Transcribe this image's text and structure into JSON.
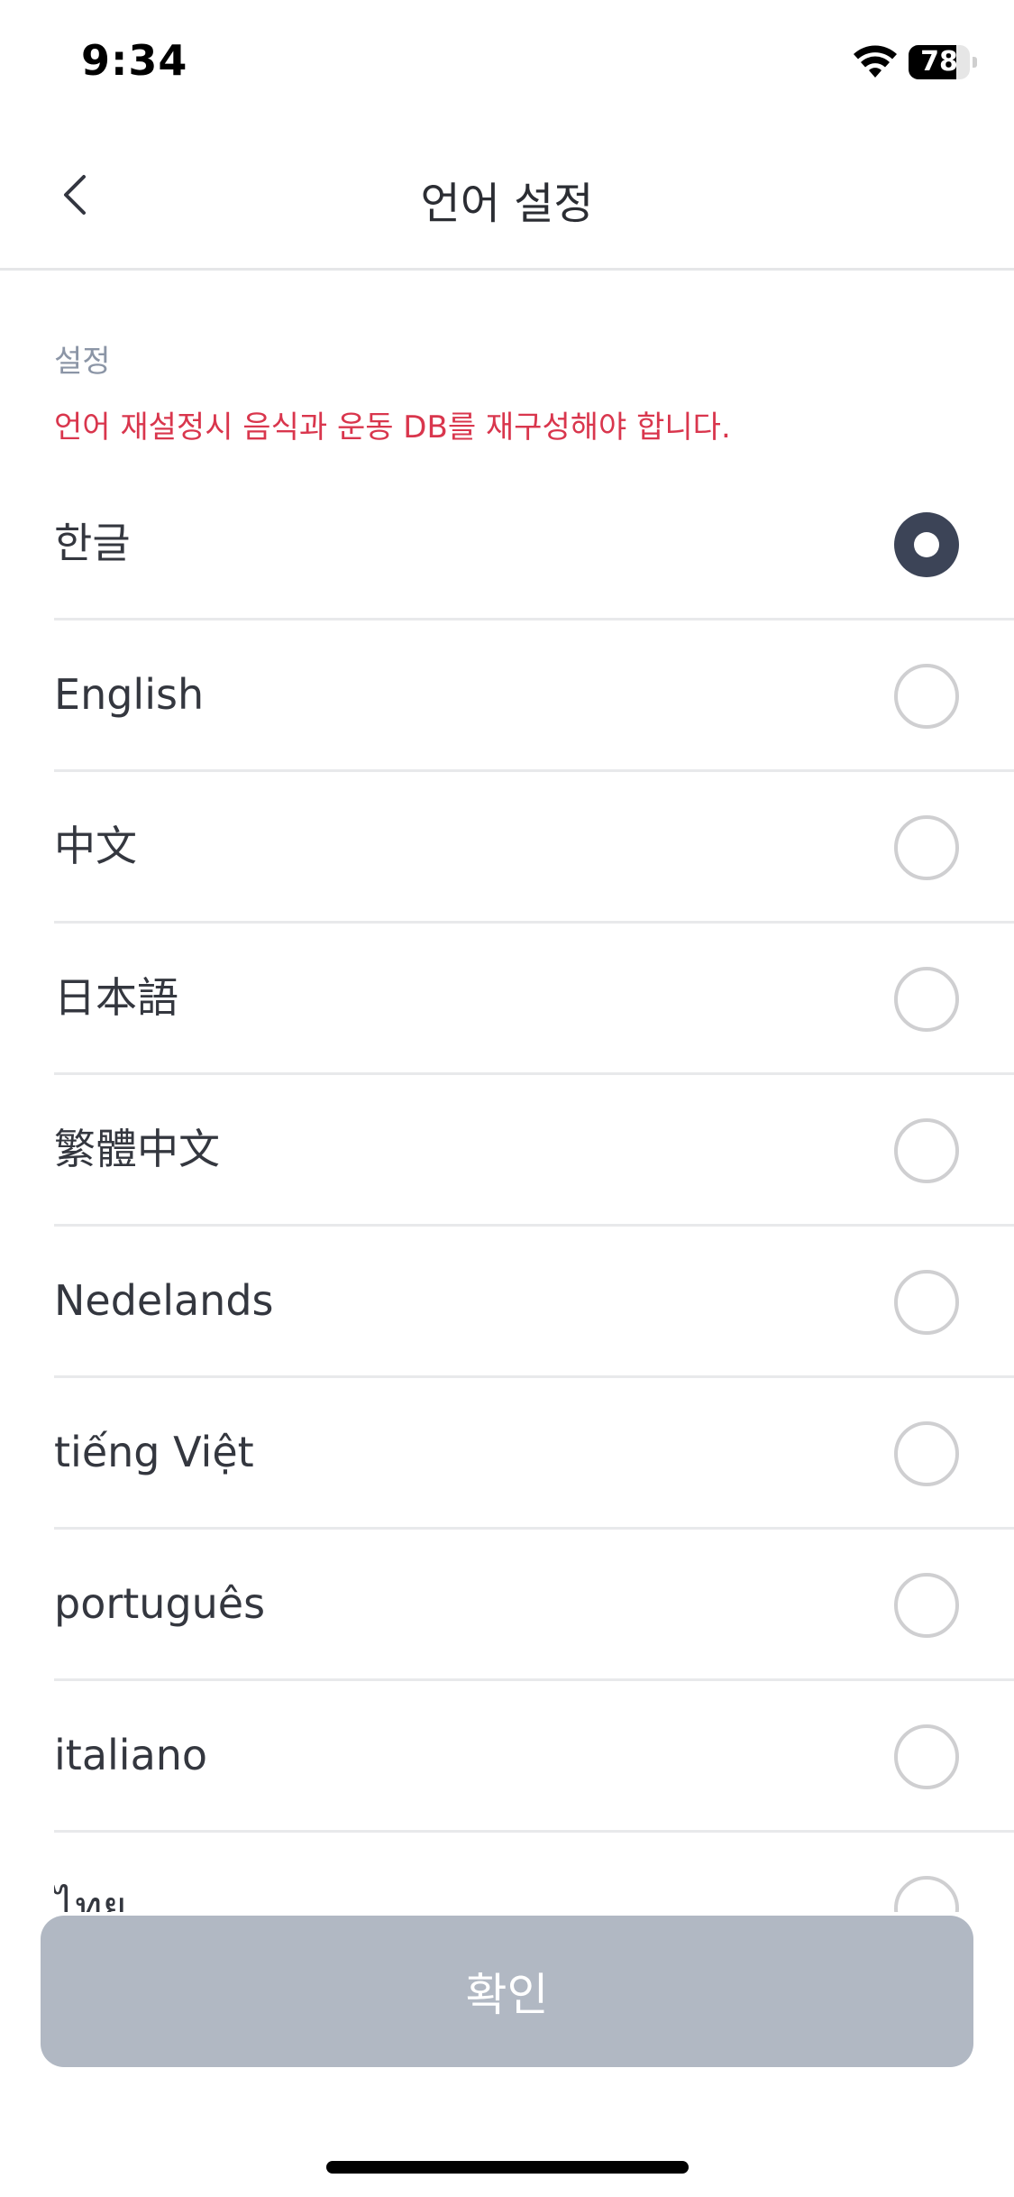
{
  "status_bar": {
    "time": "9:34",
    "battery_percent": 78,
    "battery_text": "78"
  },
  "header": {
    "title": "언어 설정"
  },
  "section": {
    "label": "설정",
    "warning": "언어 재설정시 음식과 운동 DB를 재구성해야 합니다."
  },
  "languages": [
    {
      "label": "한글",
      "selected": true
    },
    {
      "label": "English",
      "selected": false
    },
    {
      "label": "中文",
      "selected": false
    },
    {
      "label": "日本語",
      "selected": false
    },
    {
      "label": "繁體中文",
      "selected": false
    },
    {
      "label": "Nedelands",
      "selected": false
    },
    {
      "label": "tiếng Việt",
      "selected": false
    },
    {
      "label": "português",
      "selected": false
    },
    {
      "label": "italiano",
      "selected": false
    },
    {
      "label": "ไทย",
      "selected": false
    }
  ],
  "confirm_button": {
    "label": "확인"
  },
  "colors": {
    "accent": "#3c4457",
    "warning": "#d9364d",
    "button_disabled": "#b1b8c3"
  }
}
